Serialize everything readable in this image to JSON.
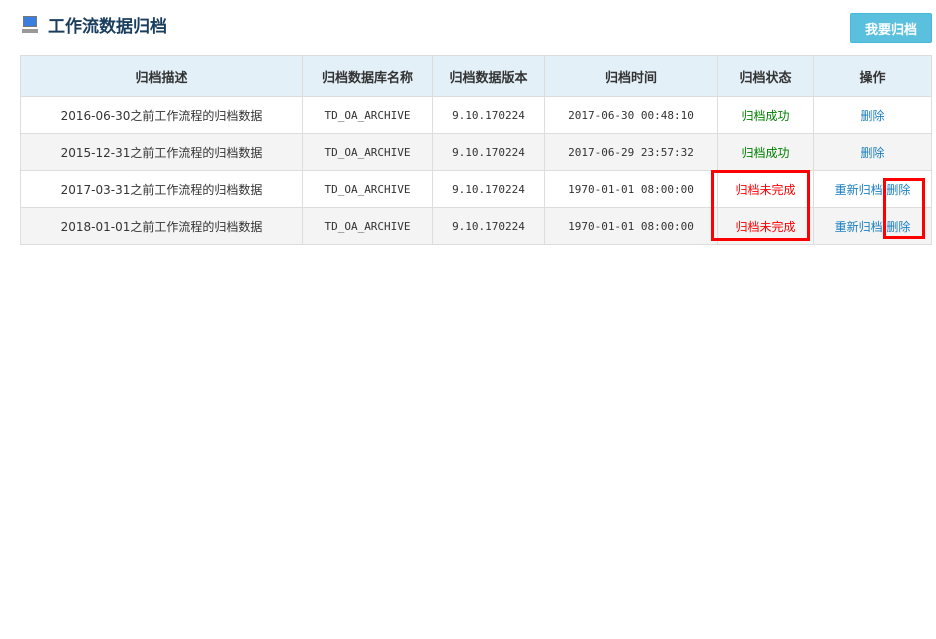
{
  "header": {
    "title": "工作流数据归档",
    "action_button": "我要归档"
  },
  "table": {
    "columns": [
      "归档描述",
      "归档数据库名称",
      "归档数据版本",
      "归档时间",
      "归档状态",
      "操作"
    ],
    "rows": [
      {
        "desc": "2016-06-30之前工作流程的归档数据",
        "db": "TD_OA_ARCHIVE",
        "version": "9.10.170224",
        "time": "2017-06-30 00:48:10",
        "status": "归档成功",
        "status_type": "success",
        "rearchive": null,
        "delete": "删除"
      },
      {
        "desc": "2015-12-31之前工作流程的归档数据",
        "db": "TD_OA_ARCHIVE",
        "version": "9.10.170224",
        "time": "2017-06-29 23:57:32",
        "status": "归档成功",
        "status_type": "success",
        "rearchive": null,
        "delete": "删除"
      },
      {
        "desc": "2017-03-31之前工作流程的归档数据",
        "db": "TD_OA_ARCHIVE",
        "version": "9.10.170224",
        "time": "1970-01-01 08:00:00",
        "status": "归档未完成",
        "status_type": "incomplete",
        "rearchive": "重新归档",
        "delete": "删除"
      },
      {
        "desc": "2018-01-01之前工作流程的归档数据",
        "db": "TD_OA_ARCHIVE",
        "version": "9.10.170224",
        "time": "1970-01-01 08:00:00",
        "status": "归档未完成",
        "status_type": "incomplete",
        "rearchive": "重新归档",
        "delete": "删除"
      }
    ]
  },
  "colors": {
    "success": "#008000",
    "incomplete": "#ff0000",
    "link": "#1a7fc1",
    "highlight": "#ff0000"
  }
}
